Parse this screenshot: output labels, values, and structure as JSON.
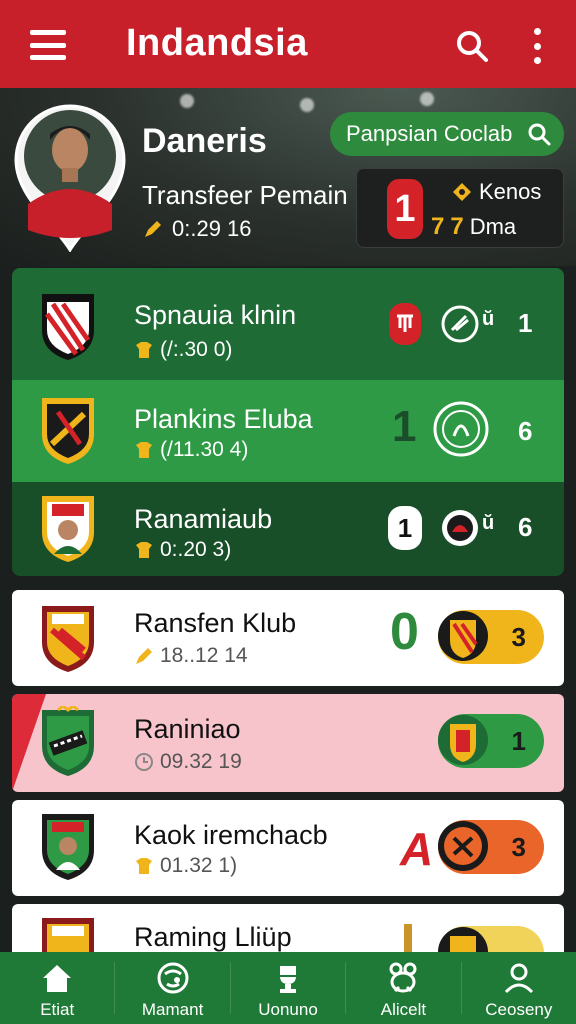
{
  "app": {
    "title": "Indandsia"
  },
  "hero": {
    "player_name": "Daneris",
    "subtitle": "Transfeer Pemain",
    "date": "0:.29 16",
    "club_search_placeholder": "Panpsian Coclab",
    "score": {
      "big": "1",
      "line1": "Kenos",
      "line2_mark": "7",
      "line2_text": "Dma"
    }
  },
  "clubs": [
    {
      "name": "Spnauia klnin",
      "meta": "(/:.30 0)",
      "badge": "1",
      "theme": "dark-green"
    },
    {
      "name": "Plankins Eluba",
      "meta": "(/11.30 4)",
      "score": "1",
      "badge": "6",
      "theme": "green"
    },
    {
      "name": "Ranamiaub",
      "meta": "0:.20 3)",
      "score": "1",
      "badge": "6",
      "theme": "deep-green"
    },
    {
      "name": "Ransfen Klub",
      "meta": "18..12 14",
      "score": "0",
      "badge": "3",
      "theme": "white"
    },
    {
      "name": "Raniniao",
      "meta": "09.32 19",
      "badge": "1",
      "theme": "pink"
    },
    {
      "name": "Kaok iremchacb",
      "meta": "01.32 1)",
      "score": "A",
      "badge": "3",
      "theme": "white"
    },
    {
      "name": "Raming Lliüp",
      "meta": "",
      "badge": "",
      "theme": "white"
    }
  ],
  "bottom_nav": [
    {
      "label": "Etiat",
      "icon": "home-icon"
    },
    {
      "label": "Mamant",
      "icon": "ball-icon"
    },
    {
      "label": "Uonuno",
      "icon": "trophy-icon"
    },
    {
      "label": "Alicelt",
      "icon": "frog-icon"
    },
    {
      "label": "Ceoseny",
      "icon": "profile-icon"
    }
  ],
  "colors": {
    "topbar": "#c8202a",
    "accent_green": "#2e8b3e",
    "nav_green": "#1f7a37",
    "gold": "#f1b51c"
  }
}
